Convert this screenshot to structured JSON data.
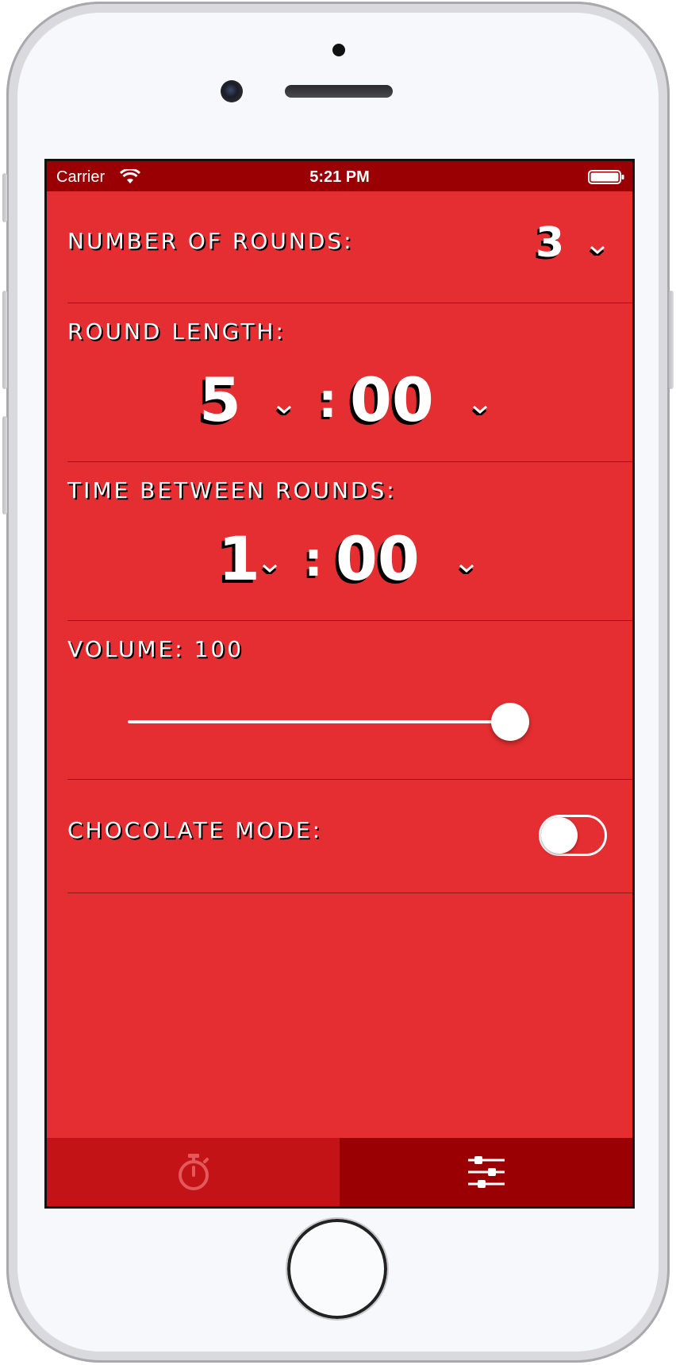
{
  "status_bar": {
    "carrier": "Carrier",
    "time": "5:21 PM"
  },
  "settings": {
    "rounds": {
      "label": "Number of rounds:",
      "value": "3"
    },
    "round_length": {
      "label": "Round length:",
      "minutes": "5",
      "colon": ":",
      "seconds": "00"
    },
    "time_between": {
      "label": "Time between rounds:",
      "minutes": "1",
      "colon": ":",
      "seconds": "00"
    },
    "volume": {
      "label": "Volume: 100",
      "value": 100,
      "max": 100
    },
    "chocolate_mode": {
      "label": "Chocolate mode:",
      "enabled": false
    }
  },
  "tabs": [
    {
      "name": "timer",
      "icon": "stopwatch-icon",
      "selected": false
    },
    {
      "name": "settings",
      "icon": "sliders-icon",
      "selected": true
    }
  ],
  "colors": {
    "background": "#e52e31",
    "status_bar": "#9a0003",
    "tab_timer": "#c41316",
    "tab_settings_selected": "#9a0003",
    "text": "#ffffff",
    "text_shadow": "#000000"
  }
}
